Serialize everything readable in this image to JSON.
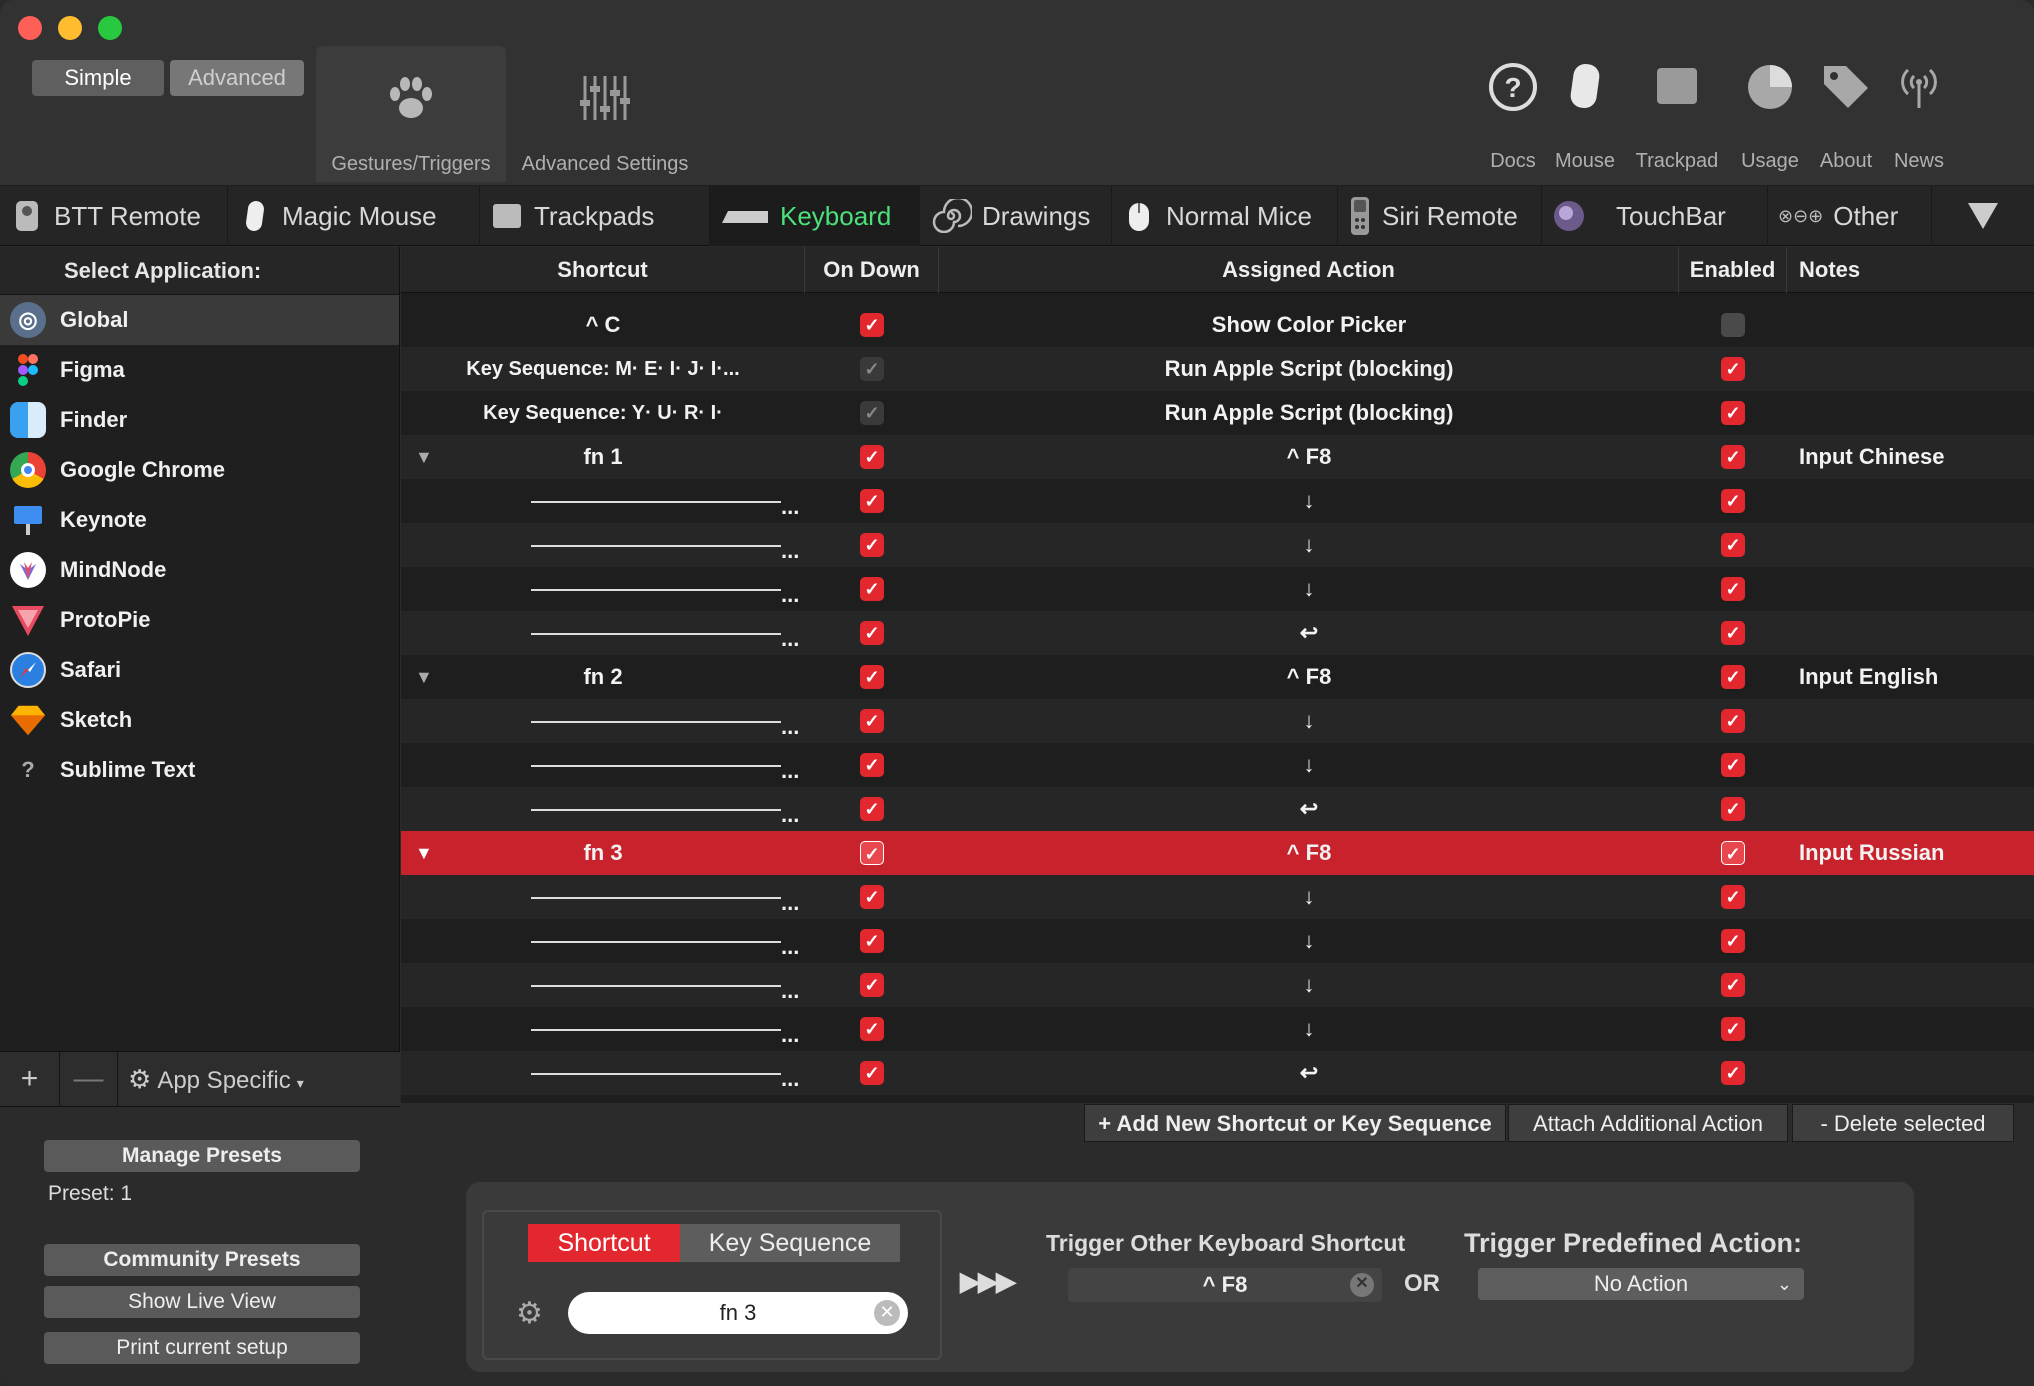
{
  "window": {
    "traffic": [
      "close",
      "minimize",
      "zoom"
    ]
  },
  "mode": {
    "simple": "Simple",
    "advanced": "Advanced"
  },
  "toolbar_left": [
    {
      "label": "Gestures/Triggers",
      "icon": "paw-icon"
    },
    {
      "label": "Advanced Settings",
      "icon": "sliders-icon"
    }
  ],
  "toolbar_right": [
    {
      "label": "Docs",
      "icon": "help-icon"
    },
    {
      "label": "Mouse",
      "icon": "mouse-icon"
    },
    {
      "label": "Trackpad",
      "icon": "trackpad-icon"
    },
    {
      "label": "Usage",
      "icon": "pie-icon"
    },
    {
      "label": "About",
      "icon": "tag-icon"
    },
    {
      "label": "News",
      "icon": "antenna-icon"
    }
  ],
  "tabs": [
    {
      "label": "BTT Remote"
    },
    {
      "label": "Magic Mouse"
    },
    {
      "label": "Trackpads"
    },
    {
      "label": "Keyboard"
    },
    {
      "label": "Drawings"
    },
    {
      "label": "Normal Mice"
    },
    {
      "label": "Siri Remote"
    },
    {
      "label": "TouchBar"
    },
    {
      "label": "Other"
    }
  ],
  "sidebar": {
    "header": "Select Application:",
    "apps": [
      {
        "name": "Global"
      },
      {
        "name": "Figma"
      },
      {
        "name": "Finder"
      },
      {
        "name": "Google Chrome"
      },
      {
        "name": "Keynote"
      },
      {
        "name": "MindNode"
      },
      {
        "name": "ProtoPie"
      },
      {
        "name": "Safari"
      },
      {
        "name": "Sketch"
      },
      {
        "name": "Sublime Text"
      }
    ],
    "add": "+",
    "remove": "—",
    "app_specific": "App Specific",
    "manage_presets": "Manage Presets",
    "preset": "Preset: 1",
    "community_presets": "Community Presets",
    "show_live_view": "Show Live View",
    "print_setup": "Print current setup"
  },
  "table": {
    "columns": [
      "Shortcut",
      "On Down",
      "Assigned Action",
      "Enabled",
      "Notes"
    ],
    "rows": [
      {
        "shortcut": "^ C",
        "on_down": true,
        "action": "Show Color Picker",
        "enabled": false,
        "notes": "",
        "kind": "plain"
      },
      {
        "shortcut": "Key Sequence:  M· E· I· J· I·...",
        "on_down": "disabled",
        "action": "Run Apple Script (blocking)",
        "enabled": true,
        "notes": "",
        "kind": "plain"
      },
      {
        "shortcut": "Key Sequence:  Y· U· R· I·",
        "on_down": "disabled",
        "action": "Run Apple Script (blocking)",
        "enabled": true,
        "notes": "",
        "kind": "plain"
      },
      {
        "shortcut": "fn  1",
        "on_down": true,
        "action": "^ F8",
        "enabled": true,
        "notes": "Input Chinese",
        "kind": "group"
      },
      {
        "shortcut": "...",
        "on_down": true,
        "action": "↓",
        "enabled": true,
        "notes": "",
        "kind": "child"
      },
      {
        "shortcut": "...",
        "on_down": true,
        "action": "↓",
        "enabled": true,
        "notes": "",
        "kind": "child"
      },
      {
        "shortcut": "...",
        "on_down": true,
        "action": "↓",
        "enabled": true,
        "notes": "",
        "kind": "child"
      },
      {
        "shortcut": "...",
        "on_down": true,
        "action": "↩",
        "enabled": true,
        "notes": "",
        "kind": "child"
      },
      {
        "shortcut": "fn  2",
        "on_down": true,
        "action": "^ F8",
        "enabled": true,
        "notes": "Input English",
        "kind": "group"
      },
      {
        "shortcut": "...",
        "on_down": true,
        "action": "↓",
        "enabled": true,
        "notes": "",
        "kind": "child"
      },
      {
        "shortcut": "...",
        "on_down": true,
        "action": "↓",
        "enabled": true,
        "notes": "",
        "kind": "child"
      },
      {
        "shortcut": "...",
        "on_down": true,
        "action": "↩",
        "enabled": true,
        "notes": "",
        "kind": "child"
      },
      {
        "shortcut": "fn  3",
        "on_down": true,
        "action": "^ F8",
        "enabled": true,
        "notes": "Input Russian",
        "kind": "group",
        "selected": true
      },
      {
        "shortcut": "...",
        "on_down": true,
        "action": "↓",
        "enabled": true,
        "notes": "",
        "kind": "child"
      },
      {
        "shortcut": "...",
        "on_down": true,
        "action": "↓",
        "enabled": true,
        "notes": "",
        "kind": "child"
      },
      {
        "shortcut": "...",
        "on_down": true,
        "action": "↓",
        "enabled": true,
        "notes": "",
        "kind": "child"
      },
      {
        "shortcut": "...",
        "on_down": true,
        "action": "↓",
        "enabled": true,
        "notes": "",
        "kind": "child"
      },
      {
        "shortcut": "...",
        "on_down": true,
        "action": "↩",
        "enabled": true,
        "notes": "",
        "kind": "child"
      }
    ]
  },
  "actions": {
    "add": "+ Add New Shortcut or Key Sequence",
    "attach": "Attach Additional Action",
    "delete": "- Delete selected"
  },
  "panel": {
    "seg_shortcut": "Shortcut",
    "seg_sequence": "Key Sequence",
    "recorded": "fn 3",
    "arrows": "▶▶▶",
    "trigger_other_label": "Trigger Other Keyboard Shortcut",
    "trigger_other_value": "^ F8",
    "or": "OR",
    "predefined_label": "Trigger Predefined Action:",
    "predefined_value": "No Action"
  },
  "colors": {
    "accent_red": "#e2272f",
    "active_tab": "#4ce07a",
    "selected_row": "#c8232c"
  }
}
